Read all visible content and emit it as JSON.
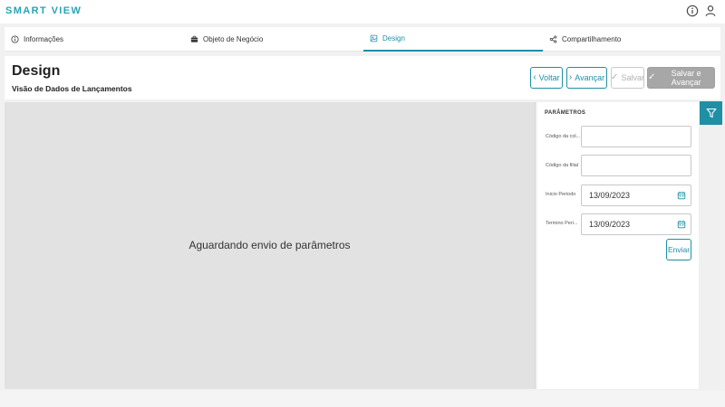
{
  "app": {
    "brand": "SMART VIEW"
  },
  "topbar": {
    "icons": [
      "info-icon",
      "user-icon"
    ]
  },
  "tabs": [
    {
      "label": "Informações",
      "icon": "info-icon",
      "active": false
    },
    {
      "label": "Objeto de Negócio",
      "icon": "briefcase-icon",
      "active": false
    },
    {
      "label": "Design",
      "icon": "design-icon",
      "active": true
    },
    {
      "label": "Compartilhamento",
      "icon": "share-icon",
      "active": false
    }
  ],
  "header": {
    "title": "Design",
    "subtitle": "Visão de Dados de Lançamentos",
    "buttons": {
      "voltar": "Voltar",
      "avancar": "Avançar",
      "salvar": "Salvar",
      "salvar_avancar": "Salvar e Avançar"
    }
  },
  "canvas": {
    "message": "Aguardando envio de parâmetros"
  },
  "params": {
    "title": "PARÂMETROS",
    "fields": [
      {
        "label": "Código da col...",
        "value": ""
      },
      {
        "label": "Código da filial",
        "value": ""
      },
      {
        "label": "Inicio Periodo",
        "value": "13/09/2023"
      },
      {
        "label": "Termino Peri...",
        "value": "13/09/2023"
      }
    ],
    "submit": "Enviar"
  },
  "colors": {
    "accent": "#1f8fa4",
    "brand": "#29a3b8",
    "disabled_bg": "#a7a7a7",
    "canvas_bg": "#e3e2e3"
  }
}
